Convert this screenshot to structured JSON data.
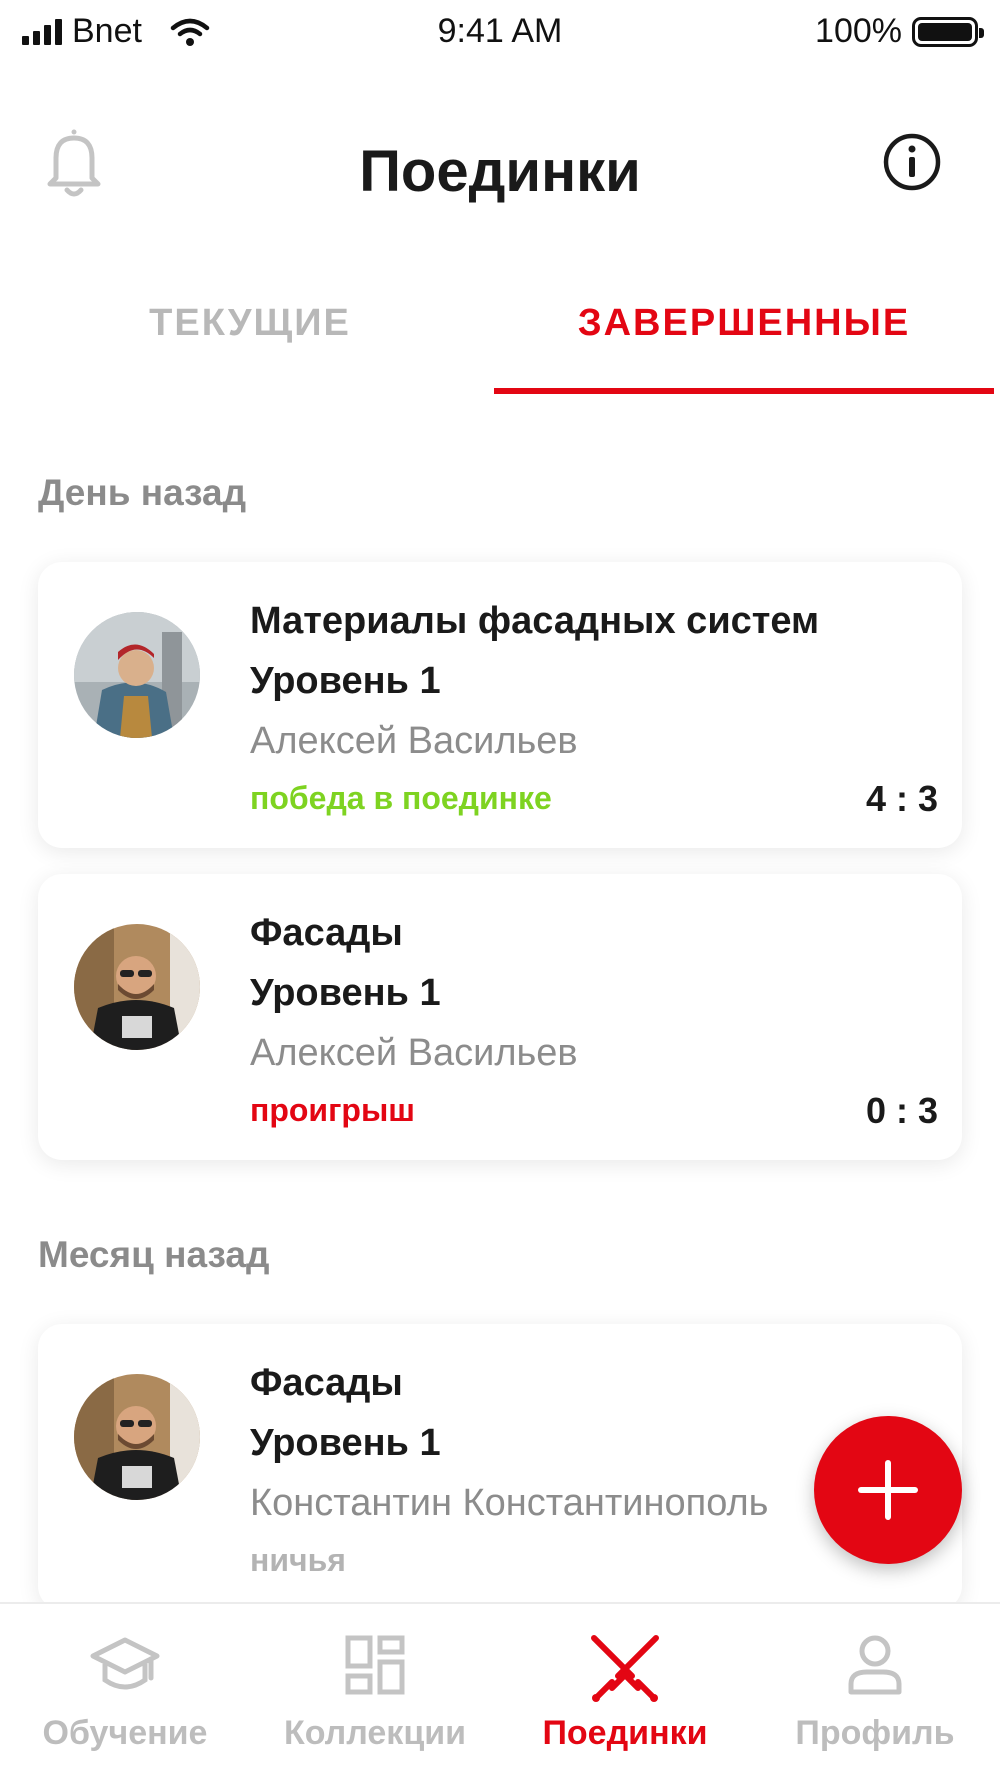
{
  "status_bar": {
    "carrier": "Bnet",
    "time": "9:41 AM",
    "battery": "100%"
  },
  "header": {
    "title": "Поединки",
    "left_icon": "bell-icon",
    "right_icon": "info-icon"
  },
  "tabs": [
    {
      "label": "ТЕКУЩИЕ",
      "active": false
    },
    {
      "label": "ЗАВЕРШЕННЫЕ",
      "active": true
    }
  ],
  "sections": [
    {
      "title": "День назад",
      "duels": [
        {
          "title": "Материалы фасадных систем",
          "level": "Уровень 1",
          "opponent": "Алексей Васильев",
          "result": "победа в поединке",
          "result_type": "win",
          "score": "4 : 3"
        },
        {
          "title": "Фасады",
          "level": "Уровень 1",
          "opponent": "Алексей Васильев",
          "result": "проигрыш",
          "result_type": "loss",
          "score": "0 : 3"
        }
      ]
    },
    {
      "title": "Месяц назад",
      "duels": [
        {
          "title": "Фасады",
          "level": "Уровень 1",
          "opponent": "Константин Константинополь",
          "result": "ничья",
          "result_type": "draw",
          "score": ""
        }
      ]
    }
  ],
  "fab_icon": "plus-icon",
  "bottom_nav": [
    {
      "label": "Обучение",
      "icon": "graduation-cap-icon",
      "active": false
    },
    {
      "label": "Коллекции",
      "icon": "grid-icon",
      "active": false
    },
    {
      "label": "Поединки",
      "icon": "crossed-swords-icon",
      "active": true
    },
    {
      "label": "Профиль",
      "icon": "person-icon",
      "active": false
    }
  ],
  "colors": {
    "accent": "#e30613",
    "win": "#7ed321",
    "muted": "#8c8c8c",
    "inactive": "#bdbdbd"
  }
}
